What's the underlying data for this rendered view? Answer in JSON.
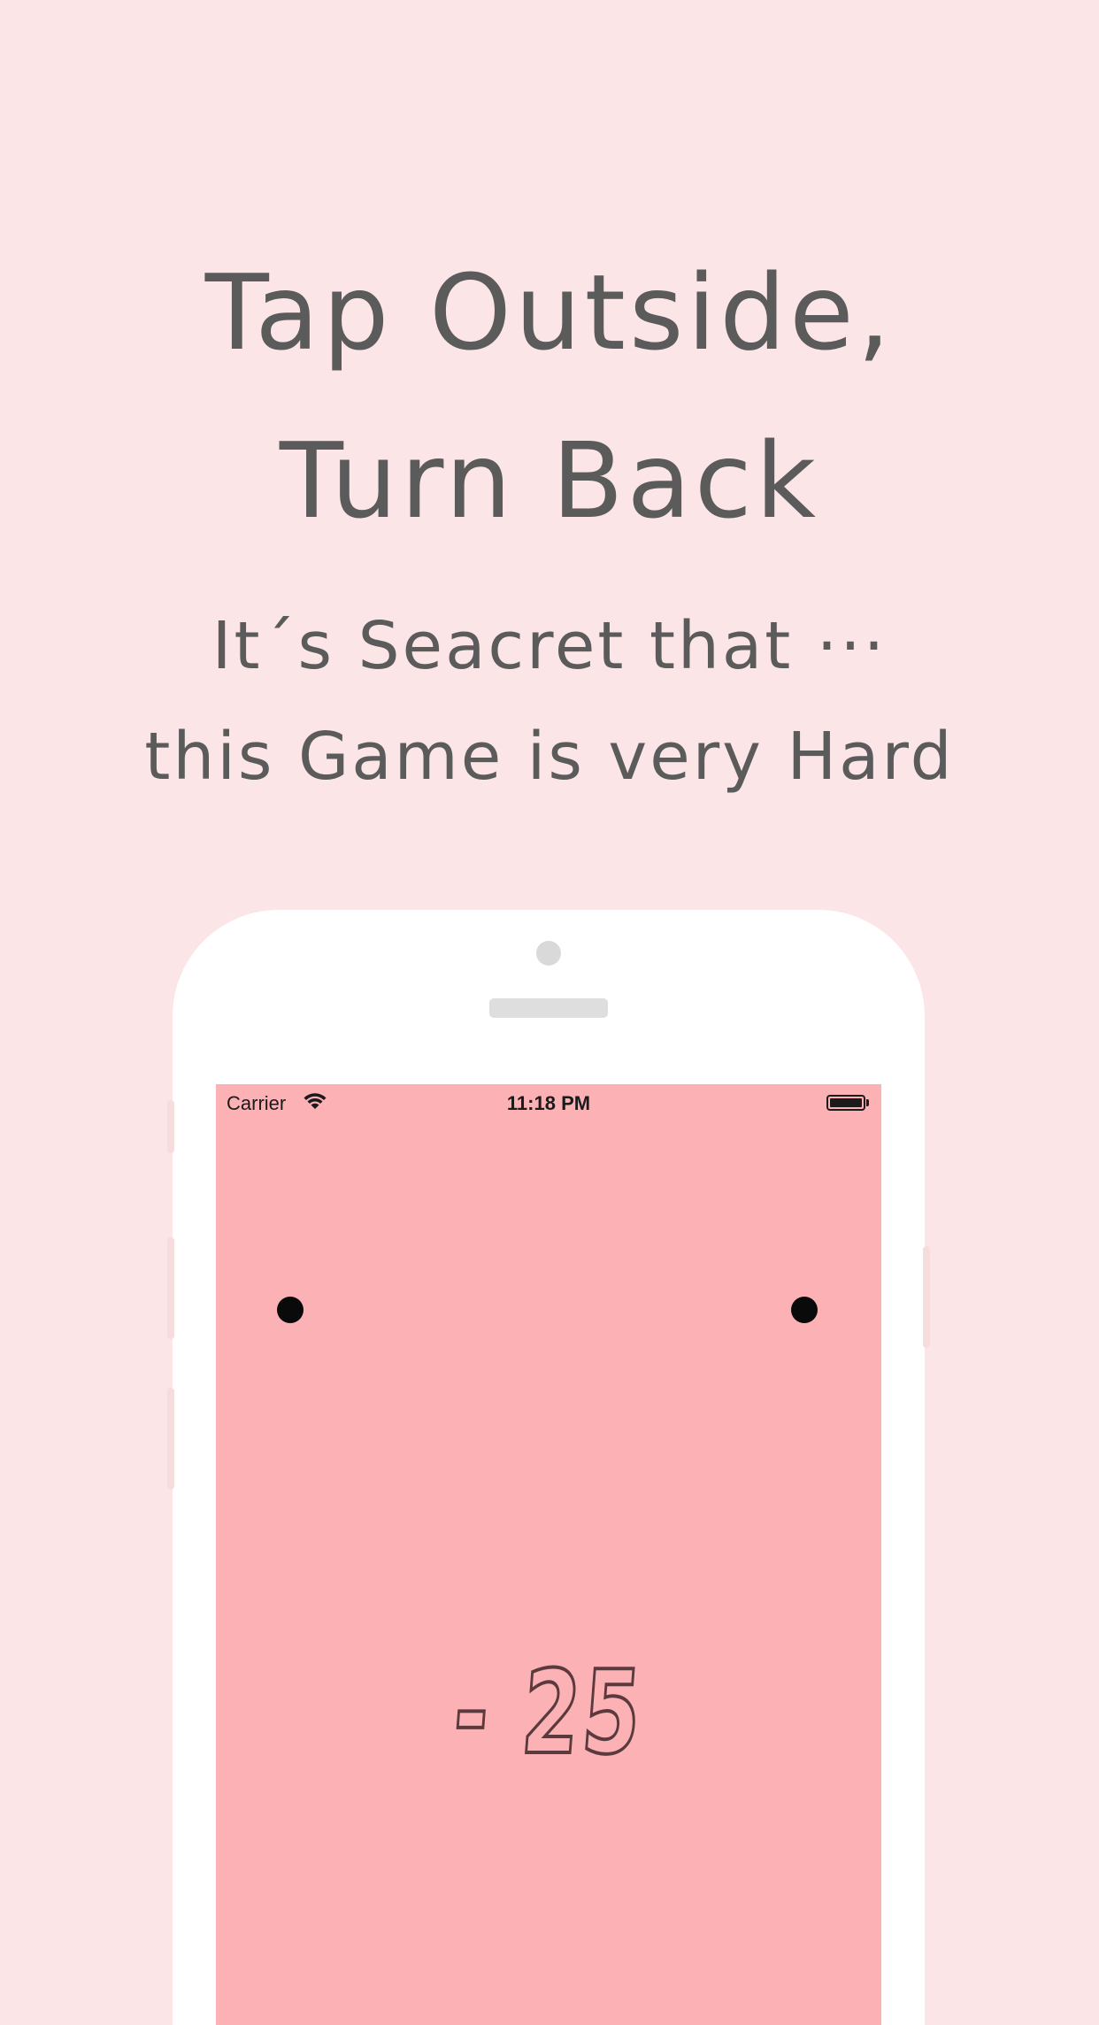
{
  "headline": {
    "title_line_1": "Tap Outside,",
    "title_line_2": "Turn Back",
    "subtitle_line_1": "It´s Seacret that ···",
    "subtitle_line_2": "this Game is very Hard"
  },
  "status_bar": {
    "carrier": "Carrier",
    "time": "11:18 PM",
    "wifi_icon": "wifi-icon",
    "battery_icon": "battery-icon",
    "battery_level": 1.0
  },
  "game": {
    "score": "- 25",
    "dot_icon": "dot"
  },
  "colors": {
    "background": "#fce5e6",
    "screen": "#fcb1b5",
    "text": "#5b5b5b",
    "phone_body": "#ffffff"
  }
}
